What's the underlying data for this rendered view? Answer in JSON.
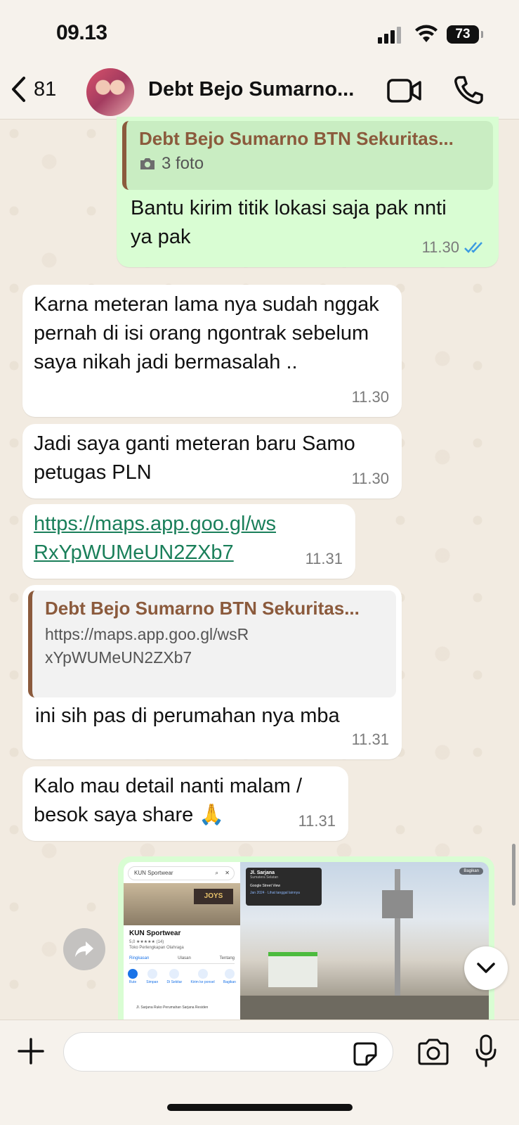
{
  "status_bar": {
    "time": "09.13",
    "battery": "73"
  },
  "header": {
    "back_count": "81",
    "title": "Debt Bejo Sumarno..."
  },
  "messages": [
    {
      "quote_author": "Debt Bejo Sumarno BTN Sekuritas...",
      "quote_text": "3 foto",
      "text": "Bantu kirim titik lokasi saja pak nnti ya pak",
      "time": "11.30"
    },
    {
      "text": "Karna meteran lama nya sudah nggak pernah di isi orang ngontrak sebelum saya nikah jadi bermasalah ..",
      "time": "11.30"
    },
    {
      "text": "Jadi saya ganti meteran baru Samo petugas PLN",
      "time": "11.30"
    },
    {
      "text": "https://maps.app.goo.gl/wsRxYpWUMeUN2ZXb7",
      "time": "11.31"
    },
    {
      "quote_author": "Debt Bejo Sumarno BTN Sekuritas...",
      "quote_text": "https://maps.app.goo.gl/wsRxYpWUMeUN2ZXb7",
      "text": "ini sih pas di perumahan nya mba",
      "time": "11.31"
    },
    {
      "text": "Kalo mau detail nanti malam / besok saya share 🙏",
      "time": "11.31"
    }
  ],
  "image_message": {
    "search_text": "KUN Sportwear",
    "place_name": "KUN Sportwear",
    "place_rating": "5,0 ★★★★★ (14)",
    "place_type": "Toko Perlengkapan Olahraga",
    "tabs": [
      "Ringkasan",
      "Ulasan",
      "Tentang"
    ],
    "actions": [
      "Rute",
      "Simpan",
      "Di Sekitar",
      "Kirim ke ponsel",
      "Bagikan"
    ],
    "address": "Jl. Sarjana Ruko Perumahan Sarjana Residen",
    "street_title": "Jl. Sarjana",
    "street_subtitle": "Sumatera Selatan",
    "street_source": "Google Street View",
    "street_date": "Jan 2024 · Lihat tanggal lainnya",
    "share_label": "Bagikan",
    "store_sign": "JOYS"
  },
  "colors": {
    "outgoing_bubble": "#d9fdd3",
    "incoming_bubble": "#ffffff",
    "quote_accent": "#8b5a3c",
    "link": "#1a7f5a",
    "read_ticks": "#3b9ae1"
  }
}
